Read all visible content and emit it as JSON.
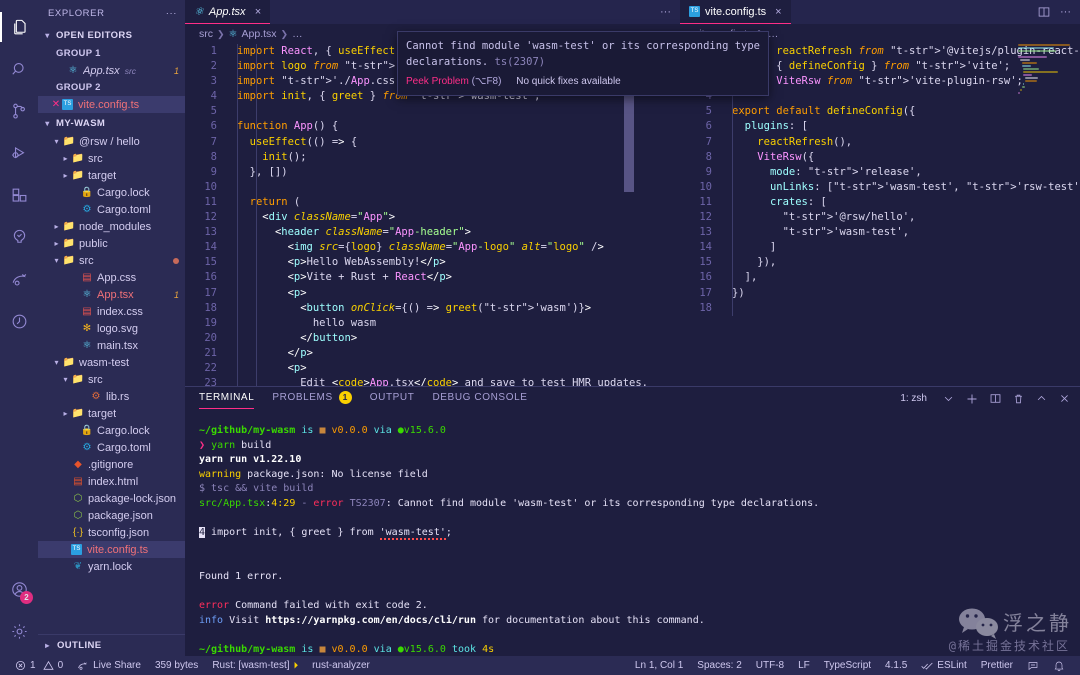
{
  "activitybar": {
    "items": [
      {
        "name": "explorer-icon",
        "glyph": "files",
        "active": true
      },
      {
        "name": "search-icon",
        "glyph": "search",
        "active": false
      },
      {
        "name": "source-control-icon",
        "glyph": "branch",
        "active": false
      },
      {
        "name": "run-and-debug-icon",
        "glyph": "debug",
        "active": false
      },
      {
        "name": "extensions-icon",
        "glyph": "blocks",
        "active": false
      },
      {
        "name": "testing-icon",
        "glyph": "beaker",
        "active": false
      },
      {
        "name": "live-share-icon",
        "glyph": "share",
        "active": false
      },
      {
        "name": "remote-explorer-icon",
        "glyph": "remote",
        "active": false
      }
    ],
    "account_badge": "2",
    "bottom": [
      {
        "name": "accounts-icon",
        "glyph": "account"
      },
      {
        "name": "manage-settings-icon",
        "glyph": "gear"
      }
    ]
  },
  "sidebar": {
    "title": "EXPLORER",
    "more_actions": "···",
    "open_editors": {
      "label": "OPEN EDITORS",
      "expanded": true,
      "groups": [
        {
          "label": "GROUP 1",
          "items": [
            {
              "name": "App.tsx",
              "sub": "src",
              "icon": "react",
              "count": "1",
              "selected": false,
              "close": false
            }
          ]
        },
        {
          "label": "GROUP 2",
          "items": [
            {
              "name": "vite.config.ts",
              "sub": "",
              "icon": "ts",
              "count": "",
              "selected": true,
              "close": true
            }
          ]
        }
      ]
    },
    "project": {
      "label": "MY-WASM",
      "expanded": true,
      "tree": [
        {
          "label": "@rsw / hello",
          "icon": "folder",
          "indent": 1,
          "twisty": "down",
          "kind": "folder"
        },
        {
          "label": "src",
          "icon": "folder-src",
          "indent": 2,
          "twisty": "right",
          "kind": "folder"
        },
        {
          "label": "target",
          "icon": "folder",
          "indent": 2,
          "twisty": "right",
          "kind": "folder"
        },
        {
          "label": "Cargo.lock",
          "icon": "lock",
          "indent": 3,
          "twisty": "",
          "kind": "file"
        },
        {
          "label": "Cargo.toml",
          "icon": "cog",
          "indent": 3,
          "twisty": "",
          "kind": "file"
        },
        {
          "label": "node_modules",
          "icon": "folder-node",
          "indent": 1,
          "twisty": "right",
          "kind": "folder"
        },
        {
          "label": "public",
          "icon": "folder-public",
          "indent": 1,
          "twisty": "right",
          "kind": "folder"
        },
        {
          "label": "src",
          "icon": "folder-src",
          "indent": 1,
          "twisty": "down",
          "kind": "folder",
          "modified": true
        },
        {
          "label": "App.css",
          "icon": "css",
          "indent": 3,
          "twisty": "",
          "kind": "file"
        },
        {
          "label": "App.tsx",
          "icon": "react",
          "indent": 3,
          "twisty": "",
          "kind": "file",
          "error": true,
          "count": "1"
        },
        {
          "label": "index.css",
          "icon": "css",
          "indent": 3,
          "twisty": "",
          "kind": "file"
        },
        {
          "label": "logo.svg",
          "icon": "svg",
          "indent": 3,
          "twisty": "",
          "kind": "file"
        },
        {
          "label": "main.tsx",
          "icon": "react",
          "indent": 3,
          "twisty": "",
          "kind": "file"
        },
        {
          "label": "wasm-test",
          "icon": "folder",
          "indent": 1,
          "twisty": "down",
          "kind": "folder"
        },
        {
          "label": "src",
          "icon": "folder-src",
          "indent": 2,
          "twisty": "down",
          "kind": "folder"
        },
        {
          "label": "lib.rs",
          "icon": "rust",
          "indent": 4,
          "twisty": "",
          "kind": "file"
        },
        {
          "label": "target",
          "icon": "folder",
          "indent": 2,
          "twisty": "right",
          "kind": "folder"
        },
        {
          "label": "Cargo.lock",
          "icon": "lock",
          "indent": 3,
          "twisty": "",
          "kind": "file"
        },
        {
          "label": "Cargo.toml",
          "icon": "cog",
          "indent": 3,
          "twisty": "",
          "kind": "file"
        },
        {
          "label": ".gitignore",
          "icon": "git",
          "indent": 2,
          "twisty": "",
          "kind": "file"
        },
        {
          "label": "index.html",
          "icon": "html",
          "indent": 2,
          "twisty": "",
          "kind": "file"
        },
        {
          "label": "package-lock.json",
          "icon": "json",
          "indent": 2,
          "twisty": "",
          "kind": "file"
        },
        {
          "label": "package.json",
          "icon": "json",
          "indent": 2,
          "twisty": "",
          "kind": "file"
        },
        {
          "label": "tsconfig.json",
          "icon": "tscfg",
          "indent": 2,
          "twisty": "",
          "kind": "file"
        },
        {
          "label": "vite.config.ts",
          "icon": "ts",
          "indent": 2,
          "twisty": "",
          "kind": "file",
          "selected": true,
          "error": true
        },
        {
          "label": "yarn.lock",
          "icon": "yarn",
          "indent": 2,
          "twisty": "",
          "kind": "file"
        }
      ]
    },
    "outline_label": "OUTLINE"
  },
  "editor_left": {
    "tab": {
      "label": "App.tsx",
      "icon": "react-icon",
      "dirty": false,
      "close": "×"
    },
    "more": "···",
    "breadcrumb": [
      "src",
      "App.tsx",
      "…"
    ],
    "lines": [
      "import React, { useEffect } from 'react';",
      "import logo from './logo.svg'",
      "import './App.css'",
      "import init, { greet } from 'wasm-test';",
      "",
      "function App() {",
      "  useEffect(() => {",
      "    init();",
      "  }, [])",
      "",
      "  return (",
      "    <div className=\"App\">",
      "      <header className=\"App-header\">",
      "        <img src={logo} className=\"App-logo\" alt=\"logo\" />",
      "        <p>Hello WebAssembly!</p>",
      "        <p>Vite + Rust + React</p>",
      "        <p>",
      "          <button onClick={() => greet('wasm')}>",
      "            hello wasm",
      "          </button>",
      "        </p>",
      "        <p>",
      "          Edit <code>App.tsx</code> and save to test HMR updates."
    ],
    "first_line": 1,
    "error_line": 4,
    "error_token": "'wasm-test'"
  },
  "hover": {
    "message": "Cannot find module 'wasm-test' or its corresponding type declarations.",
    "rule": "ts(2307)",
    "peek_label": "Peek Problem",
    "peek_shortcut": "(⌥F8)",
    "no_fixes": "No quick fixes available"
  },
  "editor_right": {
    "tab": {
      "label": "vite.config.ts",
      "icon": "ts-icon",
      "close": "×"
    },
    "split_icon": "split-editor-icon",
    "more": "···",
    "breadcrumb": [
      "vite.config.ts",
      "…"
    ],
    "lines": [
      "import reactRefresh from '@vitejs/plugin-react-refresh';",
      "import { defineConfig } from 'vite';",
      "import ViteRsw from 'vite-plugin-rsw';",
      "",
      "export default defineConfig({",
      "  plugins: [",
      "    reactRefresh(),",
      "    ViteRsw({",
      "      mode: 'release',",
      "      unLinks: ['wasm-test', 'rsw-test'],",
      "      crates: [",
      "        '@rsw/hello',",
      "        'wasm-test',",
      "      ]",
      "    }),",
      "  ],",
      "})",
      ""
    ],
    "first_line": 1
  },
  "panel": {
    "tabs": [
      {
        "label": "TERMINAL",
        "badge": "",
        "active": true
      },
      {
        "label": "PROBLEMS",
        "badge": "1",
        "active": false
      },
      {
        "label": "OUTPUT",
        "badge": "",
        "active": false
      },
      {
        "label": "DEBUG CONSOLE",
        "badge": "",
        "active": false
      }
    ],
    "terminal_selector": "1: zsh",
    "actions": [
      {
        "name": "terminal-dropdown-chevron-icon",
        "glyph": "chevron-down"
      },
      {
        "name": "new-terminal-icon",
        "glyph": "plus"
      },
      {
        "name": "split-terminal-icon",
        "glyph": "split"
      },
      {
        "name": "kill-terminal-icon",
        "glyph": "trash"
      },
      {
        "name": "maximize-panel-icon",
        "glyph": "chevron-up"
      },
      {
        "name": "close-panel-icon",
        "glyph": "close"
      }
    ],
    "terminal": {
      "prompt_path": "~/github/my-wasm",
      "prompt_is": "is",
      "pkg_version": "v0.0.0",
      "via": "via",
      "node_version": "v15.6.0",
      "command": "yarn build",
      "lines": [
        {
          "type": "yarnrun",
          "text": "yarn run v1.22.10"
        },
        {
          "type": "warning",
          "prefix": "warning",
          "text": " package.json: No license field"
        },
        {
          "type": "dim",
          "text": "$ tsc && vite build"
        },
        {
          "type": "tserror",
          "file": "src/App.tsx",
          "pos": "4:29",
          "dash": " - ",
          "errlabel": "error",
          "code": "TS2307",
          "text": ": Cannot find module 'wasm-test' or its corresponding type declarations."
        },
        {
          "type": "blank",
          "text": ""
        },
        {
          "type": "srcline",
          "num": "4",
          "text": "import init, { greet } from 'wasm-test';"
        },
        {
          "type": "blank",
          "text": ""
        },
        {
          "type": "blank",
          "text": ""
        },
        {
          "type": "plain",
          "text": "Found 1 error."
        },
        {
          "type": "blank",
          "text": ""
        },
        {
          "type": "cmdfail",
          "prefix": "error",
          "text": " Command failed with exit code 2."
        },
        {
          "type": "infoline",
          "prefix": "info",
          "pre": " Visit ",
          "url": "https://yarnpkg.com/en/docs/cli/run",
          "post": " for documentation about this command."
        }
      ],
      "final_prompt_took": "took",
      "final_prompt_duration": "4s"
    },
    "watermark": {
      "main": "浮之静",
      "sub": "@稀土掘金技术社区"
    }
  },
  "statusbar": {
    "left": [
      {
        "name": "problems-status",
        "icon": "error-circle",
        "errors": "1",
        "warn_icon": "warning-triangle",
        "warnings": "0"
      },
      {
        "name": "live-share-status",
        "icon": "live-share",
        "label": "Live Share"
      },
      {
        "name": "file-size-status",
        "label": "359 bytes"
      },
      {
        "name": "rust-target-status",
        "label": "Rust: [wasm-test]",
        "icon": "run-triangle"
      },
      {
        "name": "rust-analyzer-status",
        "label": "rust-analyzer"
      }
    ],
    "right": [
      {
        "name": "cursor-position-status",
        "label": "Ln 1, Col 1"
      },
      {
        "name": "indentation-status",
        "label": "Spaces: 2"
      },
      {
        "name": "encoding-status",
        "label": "UTF-8"
      },
      {
        "name": "eol-status",
        "label": "LF"
      },
      {
        "name": "language-mode-status",
        "label": "TypeScript"
      },
      {
        "name": "version-status",
        "label": "4.1.5"
      },
      {
        "name": "eslint-status",
        "label": "ESLint",
        "icon": "check-all"
      },
      {
        "name": "prettier-status",
        "label": "Prettier"
      },
      {
        "name": "feedback-status",
        "icon": "smiley"
      },
      {
        "name": "notifications-status",
        "icon": "bell"
      }
    ]
  },
  "colors": {
    "bg": "#1e1e3f",
    "chrome": "#2b2b54",
    "accent": "#ff2e88",
    "keyword": "#ff9d00",
    "string": "#a5ff90",
    "variable": "#9effff",
    "function": "#fad000",
    "error": "#ff2e5b"
  }
}
